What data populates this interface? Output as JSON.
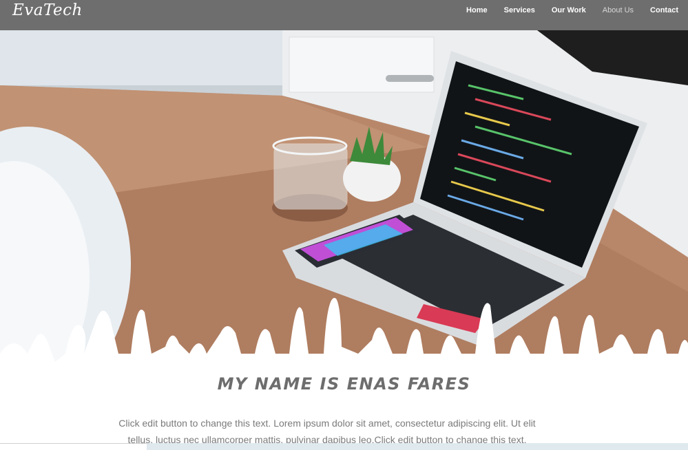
{
  "brand": {
    "logo": "EvaTech"
  },
  "nav": {
    "items": [
      {
        "label": "Home"
      },
      {
        "label": "Services"
      },
      {
        "label": "Our Work"
      },
      {
        "label": "About Us"
      },
      {
        "label": "Contact"
      }
    ]
  },
  "hero": {
    "screen_code_text": ""
  },
  "main": {
    "title": "MY NAME IS ENAS FARES",
    "paragraph": "Click edit button to change this text. Lorem ipsum dolor sit amet, consectetur adipiscing elit. Ut elit tellus, luctus nec ullamcorper mattis, pulvinar dapibus leo.Click edit button to change this text."
  },
  "colors": {
    "header_bg": "#6e6e6e",
    "title": "#6d6d6d",
    "text": "#7a7a7a"
  }
}
